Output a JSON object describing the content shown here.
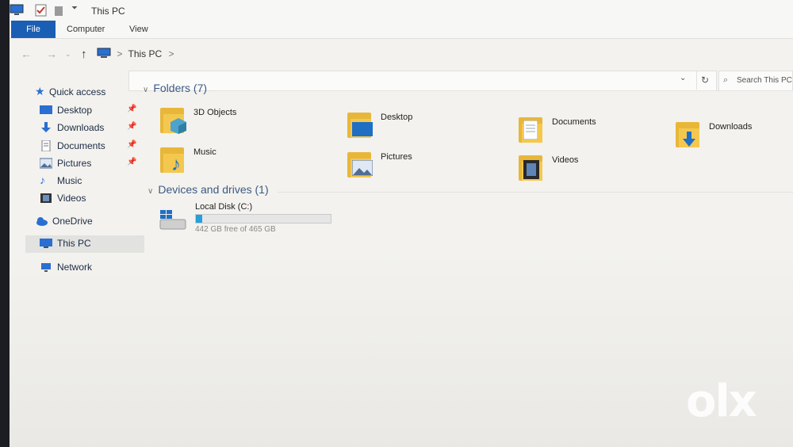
{
  "window": {
    "title": "This PC"
  },
  "ribbon": {
    "tabs": [
      "File",
      "Computer",
      "View"
    ]
  },
  "address": {
    "breadcrumb": "This PC",
    "separator": ">"
  },
  "search": {
    "placeholder": "Search This PC"
  },
  "nav_pane": {
    "quick_access": "Quick access",
    "items": [
      {
        "label": "Desktop",
        "icon": "desktop-icon",
        "pinned": true
      },
      {
        "label": "Downloads",
        "icon": "downloads-icon",
        "pinned": true
      },
      {
        "label": "Documents",
        "icon": "documents-icon",
        "pinned": true
      },
      {
        "label": "Pictures",
        "icon": "pictures-icon",
        "pinned": true
      },
      {
        "label": "Music",
        "icon": "music-icon",
        "pinned": false
      },
      {
        "label": "Videos",
        "icon": "videos-icon",
        "pinned": false
      }
    ],
    "onedrive": "OneDrive",
    "this_pc": "This PC",
    "network": "Network"
  },
  "folders_section": {
    "heading": "Folders (7)",
    "items": [
      {
        "label": "3D Objects",
        "icon": "3d-objects-folder-icon"
      },
      {
        "label": "Desktop",
        "icon": "desktop-folder-icon"
      },
      {
        "label": "Documents",
        "icon": "documents-folder-icon"
      },
      {
        "label": "Downloads",
        "icon": "downloads-folder-icon"
      },
      {
        "label": "Music",
        "icon": "music-folder-icon"
      },
      {
        "label": "Pictures",
        "icon": "pictures-folder-icon"
      },
      {
        "label": "Videos",
        "icon": "videos-folder-icon"
      }
    ]
  },
  "devices_section": {
    "heading": "Devices and drives (1)",
    "drive": {
      "name": "Local Disk (C:)",
      "free_text": "442 GB free of 465 GB",
      "used_fraction": 0.049
    }
  },
  "watermark": "olx",
  "colors": {
    "accent": "#1a5fb4",
    "folder": "#f4c84f",
    "drive_bar": "#26a0da"
  }
}
